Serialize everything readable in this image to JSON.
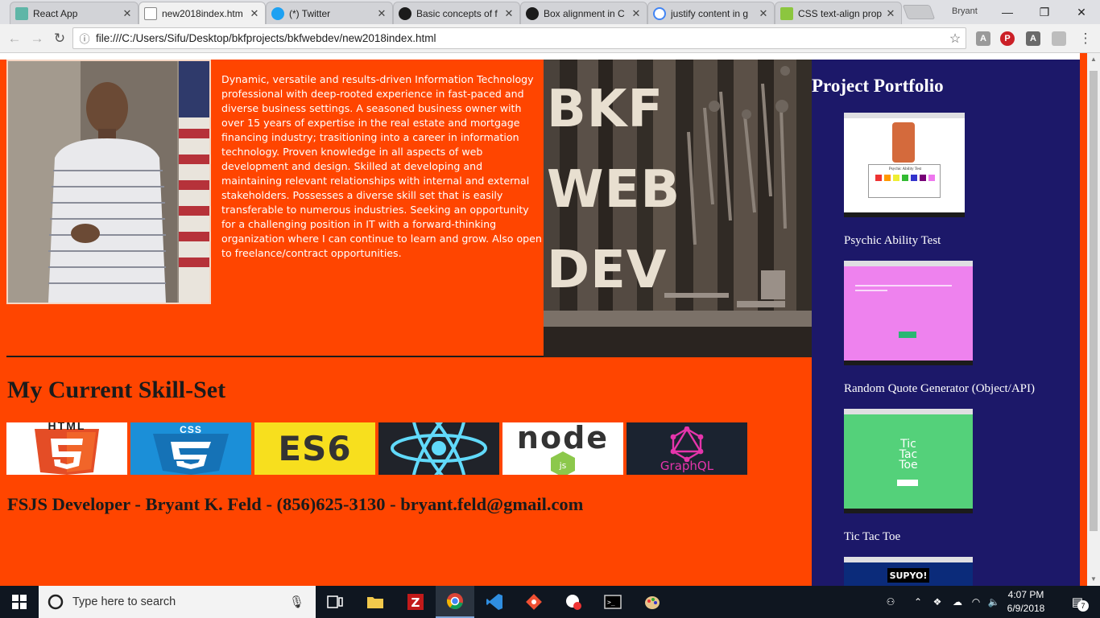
{
  "browser": {
    "tabs": [
      {
        "title": "React App",
        "favicon_color": "#5fb6a7"
      },
      {
        "title": "new2018index.htm",
        "favicon_color": "#ffffff"
      },
      {
        "title": "(*) Twitter",
        "favicon_color": "#1da1f2"
      },
      {
        "title": "Basic concepts of f",
        "favicon_color": "#1b1b1b"
      },
      {
        "title": "Box alignment in C",
        "favicon_color": "#1b1b1b"
      },
      {
        "title": "justify content in g",
        "favicon_color": "#ffffff"
      },
      {
        "title": "CSS text-align prop",
        "favicon_color": "#8cc63f"
      }
    ],
    "active_tab": 1,
    "user": "Bryant",
    "url": "file:///C:/Users/Sifu/Desktop/bkfprojects/bkfwebdev/new2018index.html"
  },
  "page": {
    "bio": "Dynamic, versatile and results-driven Information Technology professional with deep-rooted experience in fast-paced and diverse business settings. A seasoned business owner with over 15 years of expertise in the real estate and mortgage financing industry; trasitioning into a career in information technology. Proven knowledge in all aspects of web development and design. Skilled at developing and maintaining relevant relationships with internal and external stakeholders. Possesses a diverse skill set that is easily transferable to numerous industries. Seeking an opportunity for a challenging position in IT with a forward-thinking organization where I can continue to learn and grow. Also open to freelance/contract opportunities.",
    "hero_lines": [
      "BKF",
      "WEB",
      "DEV"
    ],
    "skills_heading": "My Current Skill-Set",
    "skills": [
      {
        "label": "HTML",
        "bg": "#ffffff",
        "color": "#e44d26"
      },
      {
        "label": "CSS",
        "bg": "#1b8fd8",
        "color": "#ffffff"
      },
      {
        "label": "ES6",
        "bg": "#f7df1e",
        "color": "#333333"
      },
      {
        "label": "React",
        "bg": "#20232a",
        "color": "#61dafb"
      },
      {
        "label": "node js",
        "bg": "#ffffff",
        "color": "#333333"
      },
      {
        "label": "GraphQL",
        "bg": "#1b2330",
        "color": "#e535ab"
      }
    ],
    "contact": "FSJS Developer - Bryant K. Feld - (856)625-3130 - bryant.feld@gmail.com",
    "portfolio_title": "Project Portfolio",
    "projects": [
      {
        "label": "Psychic Ability Test",
        "thumb_bg": "#ffffff",
        "thumb_title": "Psychic Ability Test"
      },
      {
        "label": "Random Quote Generator (Object/API)",
        "thumb_bg": "#ee82ee"
      },
      {
        "label": "Tic Tac Toe",
        "thumb_bg": "#54d17a",
        "thumb_title": "Tic Tac Toe"
      },
      {
        "label": "",
        "thumb_bg": "#0b2b7a",
        "thumb_title": "SUPYO!"
      }
    ],
    "colors": {
      "left_bg": "#ff4500",
      "right_bg": "#1c1869"
    }
  },
  "taskbar": {
    "search_placeholder": "Type here to search",
    "time": "4:07 PM",
    "date": "6/9/2018",
    "notification_count": "7"
  }
}
